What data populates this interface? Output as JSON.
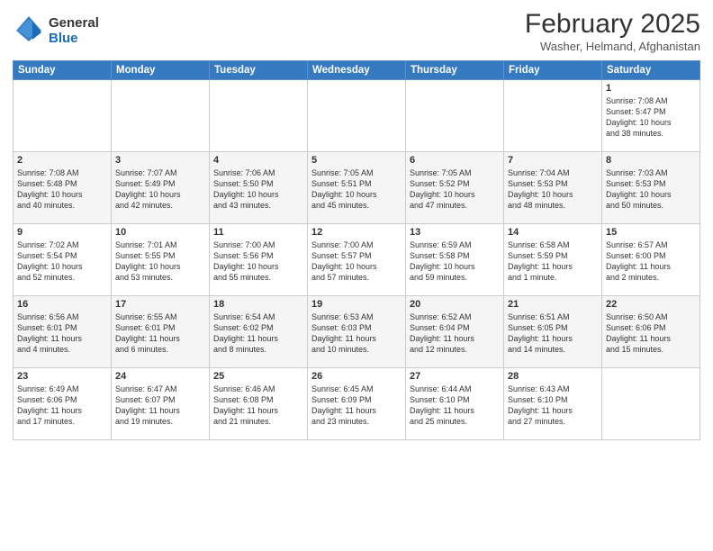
{
  "logo": {
    "general": "General",
    "blue": "Blue"
  },
  "header": {
    "month_year": "February 2025",
    "location": "Washer, Helmand, Afghanistan"
  },
  "days_of_week": [
    "Sunday",
    "Monday",
    "Tuesday",
    "Wednesday",
    "Thursday",
    "Friday",
    "Saturday"
  ],
  "weeks": [
    [
      {
        "day": "",
        "info": ""
      },
      {
        "day": "",
        "info": ""
      },
      {
        "day": "",
        "info": ""
      },
      {
        "day": "",
        "info": ""
      },
      {
        "day": "",
        "info": ""
      },
      {
        "day": "",
        "info": ""
      },
      {
        "day": "1",
        "info": "Sunrise: 7:08 AM\nSunset: 5:47 PM\nDaylight: 10 hours\nand 38 minutes."
      }
    ],
    [
      {
        "day": "2",
        "info": "Sunrise: 7:08 AM\nSunset: 5:48 PM\nDaylight: 10 hours\nand 40 minutes."
      },
      {
        "day": "3",
        "info": "Sunrise: 7:07 AM\nSunset: 5:49 PM\nDaylight: 10 hours\nand 42 minutes."
      },
      {
        "day": "4",
        "info": "Sunrise: 7:06 AM\nSunset: 5:50 PM\nDaylight: 10 hours\nand 43 minutes."
      },
      {
        "day": "5",
        "info": "Sunrise: 7:05 AM\nSunset: 5:51 PM\nDaylight: 10 hours\nand 45 minutes."
      },
      {
        "day": "6",
        "info": "Sunrise: 7:05 AM\nSunset: 5:52 PM\nDaylight: 10 hours\nand 47 minutes."
      },
      {
        "day": "7",
        "info": "Sunrise: 7:04 AM\nSunset: 5:53 PM\nDaylight: 10 hours\nand 48 minutes."
      },
      {
        "day": "8",
        "info": "Sunrise: 7:03 AM\nSunset: 5:53 PM\nDaylight: 10 hours\nand 50 minutes."
      }
    ],
    [
      {
        "day": "9",
        "info": "Sunrise: 7:02 AM\nSunset: 5:54 PM\nDaylight: 10 hours\nand 52 minutes."
      },
      {
        "day": "10",
        "info": "Sunrise: 7:01 AM\nSunset: 5:55 PM\nDaylight: 10 hours\nand 53 minutes."
      },
      {
        "day": "11",
        "info": "Sunrise: 7:00 AM\nSunset: 5:56 PM\nDaylight: 10 hours\nand 55 minutes."
      },
      {
        "day": "12",
        "info": "Sunrise: 7:00 AM\nSunset: 5:57 PM\nDaylight: 10 hours\nand 57 minutes."
      },
      {
        "day": "13",
        "info": "Sunrise: 6:59 AM\nSunset: 5:58 PM\nDaylight: 10 hours\nand 59 minutes."
      },
      {
        "day": "14",
        "info": "Sunrise: 6:58 AM\nSunset: 5:59 PM\nDaylight: 11 hours\nand 1 minute."
      },
      {
        "day": "15",
        "info": "Sunrise: 6:57 AM\nSunset: 6:00 PM\nDaylight: 11 hours\nand 2 minutes."
      }
    ],
    [
      {
        "day": "16",
        "info": "Sunrise: 6:56 AM\nSunset: 6:01 PM\nDaylight: 11 hours\nand 4 minutes."
      },
      {
        "day": "17",
        "info": "Sunrise: 6:55 AM\nSunset: 6:01 PM\nDaylight: 11 hours\nand 6 minutes."
      },
      {
        "day": "18",
        "info": "Sunrise: 6:54 AM\nSunset: 6:02 PM\nDaylight: 11 hours\nand 8 minutes."
      },
      {
        "day": "19",
        "info": "Sunrise: 6:53 AM\nSunset: 6:03 PM\nDaylight: 11 hours\nand 10 minutes."
      },
      {
        "day": "20",
        "info": "Sunrise: 6:52 AM\nSunset: 6:04 PM\nDaylight: 11 hours\nand 12 minutes."
      },
      {
        "day": "21",
        "info": "Sunrise: 6:51 AM\nSunset: 6:05 PM\nDaylight: 11 hours\nand 14 minutes."
      },
      {
        "day": "22",
        "info": "Sunrise: 6:50 AM\nSunset: 6:06 PM\nDaylight: 11 hours\nand 15 minutes."
      }
    ],
    [
      {
        "day": "23",
        "info": "Sunrise: 6:49 AM\nSunset: 6:06 PM\nDaylight: 11 hours\nand 17 minutes."
      },
      {
        "day": "24",
        "info": "Sunrise: 6:47 AM\nSunset: 6:07 PM\nDaylight: 11 hours\nand 19 minutes."
      },
      {
        "day": "25",
        "info": "Sunrise: 6:46 AM\nSunset: 6:08 PM\nDaylight: 11 hours\nand 21 minutes."
      },
      {
        "day": "26",
        "info": "Sunrise: 6:45 AM\nSunset: 6:09 PM\nDaylight: 11 hours\nand 23 minutes."
      },
      {
        "day": "27",
        "info": "Sunrise: 6:44 AM\nSunset: 6:10 PM\nDaylight: 11 hours\nand 25 minutes."
      },
      {
        "day": "28",
        "info": "Sunrise: 6:43 AM\nSunset: 6:10 PM\nDaylight: 11 hours\nand 27 minutes."
      },
      {
        "day": "",
        "info": ""
      }
    ]
  ]
}
